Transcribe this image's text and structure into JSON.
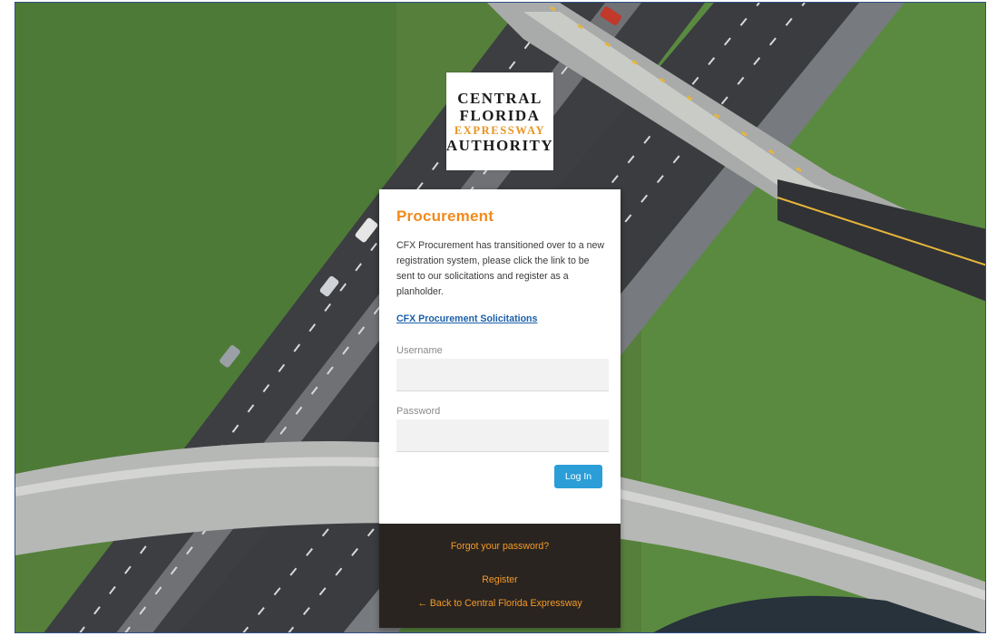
{
  "logo": {
    "line1": "CENTRAL",
    "line2": "FLORIDA",
    "line3": "EXPRESSWAY",
    "line4": "AUTHORITY"
  },
  "card": {
    "title": "Procurement",
    "description": "CFX Procurement has transitioned over to a new registration system, please click the link to be sent to our solicitations and register as a planholder.",
    "solicitations_link": "CFX Procurement Solicitations",
    "username_label": "Username",
    "username_value": "",
    "password_label": "Password",
    "password_value": "",
    "login_button": "Log In"
  },
  "footer": {
    "forgot_password": "Forgot your password?",
    "register": "Register",
    "back_link": "← Back to Central Florida Expressway"
  },
  "colors": {
    "accent_orange": "#f08a1c",
    "link_blue": "#1a5fa8",
    "button_blue": "#2b9ed8",
    "footer_dark": "#2a2420"
  }
}
